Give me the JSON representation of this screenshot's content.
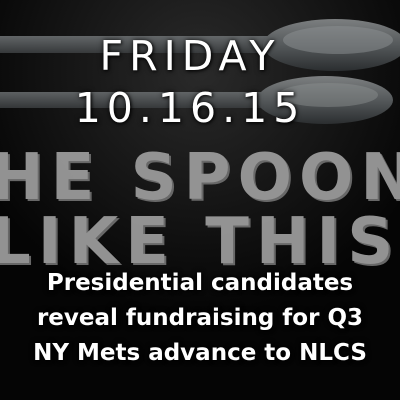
{
  "background": {
    "lines": [
      "HE SPOON",
      "LIKE THIS?"
    ],
    "text_color": "#9a9a9a",
    "image": "photo of two spoons on a dark background"
  },
  "date": {
    "weekday": "FRIDAY",
    "date": "10.16.15"
  },
  "headlines": [
    "Presidential candidates",
    "reveal fundraising for Q3",
    "NY Mets advance to NLCS"
  ]
}
